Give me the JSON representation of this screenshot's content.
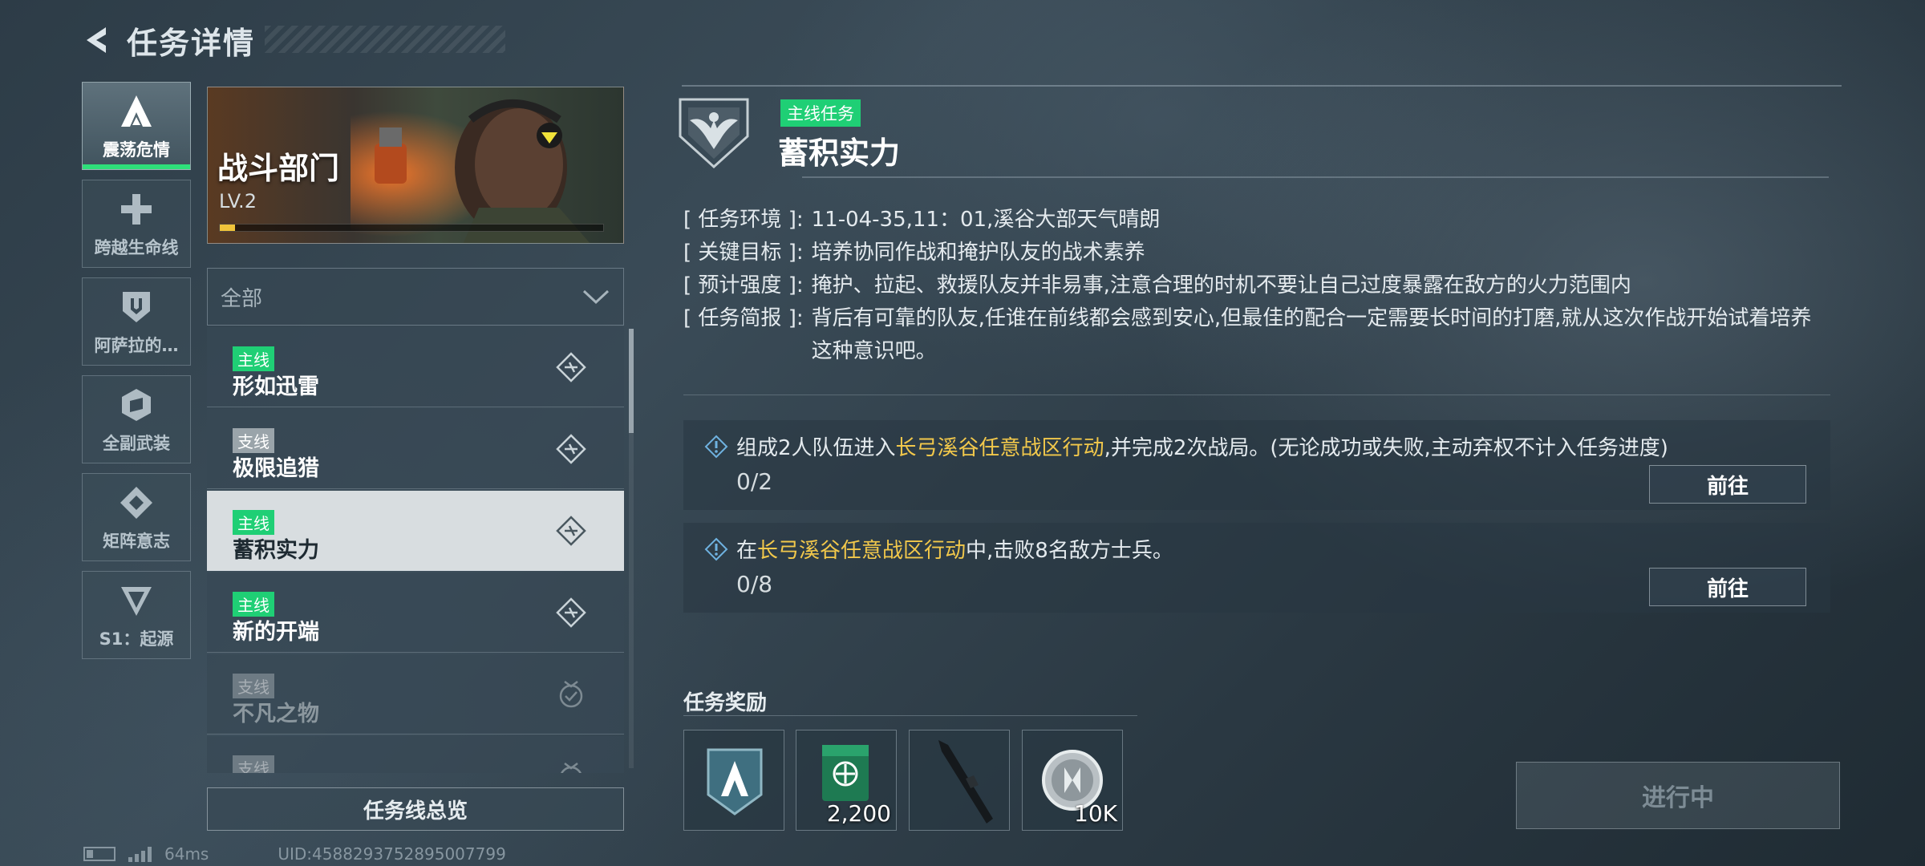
{
  "header": {
    "title": "任务详情"
  },
  "categories": [
    {
      "label": "震荡危情",
      "icon": "a-logo-icon",
      "active": true
    },
    {
      "label": "跨越生命线",
      "icon": "cross-icon"
    },
    {
      "label": "阿萨拉的…",
      "icon": "shield-icon"
    },
    {
      "label": "全副武装",
      "icon": "hex-icon"
    },
    {
      "label": "矩阵意志",
      "icon": "diamond-icon"
    },
    {
      "label": "S1：起源",
      "icon": "v-triangle-icon"
    }
  ],
  "department": {
    "name": "战斗部门",
    "level": "LV.2",
    "progress": 0.04
  },
  "filter": {
    "value": "全部"
  },
  "missions": [
    {
      "tag": "主线",
      "kind": "main",
      "name": "形如迅雷",
      "state": "in-progress"
    },
    {
      "tag": "支线",
      "kind": "side",
      "name": "极限追猎",
      "state": "in-progress"
    },
    {
      "tag": "主线",
      "kind": "main",
      "name": "蓄积实力",
      "state": "in-progress",
      "selected": true
    },
    {
      "tag": "主线",
      "kind": "main",
      "name": "新的开端",
      "state": "in-progress"
    },
    {
      "tag": "支线",
      "kind": "side",
      "name": "不凡之物",
      "state": "completed"
    },
    {
      "tag": "支线",
      "kind": "side",
      "name": "",
      "state": "completed"
    }
  ],
  "overview_button": "任务线总览",
  "status": {
    "ping": "64ms",
    "uid": "UID:4588293752895007799"
  },
  "detail": {
    "type_tag": "主线任务",
    "title": "蓄积实力",
    "info": [
      {
        "k": "任务环境",
        "v": "11-04-35,11：01,溪谷大部天气晴朗"
      },
      {
        "k": "关键目标",
        "v": "培养协同作战和掩护队友的战术素养"
      },
      {
        "k": "预计强度",
        "v": "掩护、拉起、救援队友并非易事,注意合理的时机不要让自己过度暴露在敌方的火力范围内"
      },
      {
        "k": "任务简报",
        "v": "背后有可靠的队友,任谁在前线都会感到安心,但最佳的配合一定需要长时间的打磨,就从这次作战开始试着培养这种意识吧。"
      }
    ],
    "objectives": [
      {
        "pre": "组成2人队伍进入",
        "hl": "长弓溪谷任意战区行动",
        "post": ",并完成2次战局。(无论成功或失败,主动弃权不计入任务进度)",
        "progress": "0/2",
        "button": "前往"
      },
      {
        "pre": "在",
        "hl": "长弓溪谷任意战区行动",
        "post": "中,击败8名敌方士兵。",
        "progress": "0/8",
        "button": "前往"
      }
    ],
    "rewards_title": "任务奖励",
    "rewards": [
      {
        "icon": "a-badge-icon",
        "count": ""
      },
      {
        "icon": "supply-crate-icon",
        "count": "2,200"
      },
      {
        "icon": "rifle-icon",
        "count": ""
      },
      {
        "icon": "coin-icon",
        "count": "10K"
      }
    ],
    "state_button": "进行中"
  },
  "colors": {
    "accent_green": "#1fcf75",
    "highlight_yellow": "#f2c84b",
    "progress_yellow": "#f0c33a"
  }
}
